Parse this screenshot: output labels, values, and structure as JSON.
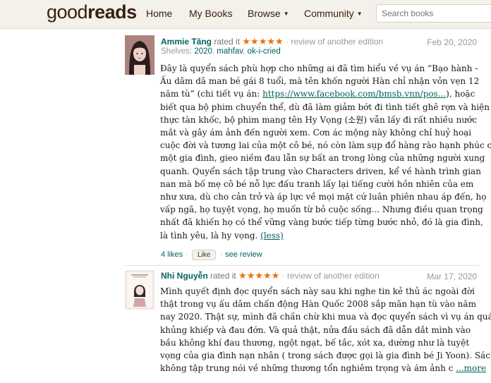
{
  "header": {
    "logo_light": "good",
    "logo_bold": "reads",
    "nav": [
      {
        "label": "Home"
      },
      {
        "label": "My Books"
      },
      {
        "label": "Browse"
      },
      {
        "label": "Community"
      }
    ],
    "search_placeholder": "Search books"
  },
  "reviews": [
    {
      "user": "Ammie Tăng",
      "rated": "rated it",
      "stars": "★★★★★",
      "edition": "review of another edition",
      "date": "Feb 20, 2020",
      "shelves_label": "Shelves:",
      "shelves": [
        "2020",
        "mahfav",
        "ok-i-cried"
      ],
      "lines": [
        "Đây là quyển sách phù hợp cho những ai đã tìm hiểu về vụ án “Bạo hành -",
        "Ấu dâm dã man bé gái 8 tuổi, mà tên khốn người Hàn chỉ nhận vỏn vẹn 12",
        "năm tù” (chi tiết vụ án: ",
        "biết qua bộ phim chuyển thể, dù đã làm giảm bớt đi tình tiết ghê rợn và hiện",
        "thực tàn khốc, bộ phim mang tên Hy Vọng (소원) vẫn lấy đi rất nhiều nước",
        "mắt và gây ám ảnh đến người xem. Cơn ác mộng này không chỉ huỷ hoại",
        "cuộc đời và tương lai của một cô bé, nó còn làm sụp đổ hàng rào hạnh phúc của",
        "một gia đình, gieo niềm đau lẫn sự bất an trong lòng của những người xung",
        "quanh. Quyển sách tập trung vào Characters driven, kể về hành trình gian",
        "nan mà bố mẹ cô bé nỗ lực đấu tranh lấy lại tiếng cười hồn nhiên của em",
        "như xưa, dù cho cản trở và áp lực về mọi mặt cứ luân phiên nhau áp đến, họ",
        "vấp ngã, họ tuyệt vọng, họ muốn từ bỏ cuộc sống... Nhưng điều quan trọng",
        "nhất đã khiến họ có thể vững vàng bước tiếp từng bước nhỏ, đó là gia đình,",
        "là tình yêu, là hy vọng. "
      ],
      "link_text": "https://www.facebook.com/bmsb.vnn/pos...",
      "link_after": "), hoặc",
      "less_text": "(less)",
      "likes": "4 likes",
      "like_button": "Like",
      "see_review": "see review"
    },
    {
      "user": "Nhi Nguyễn",
      "rated": "rated it",
      "stars": "★★★★★",
      "edition": "review of another edition",
      "date": "Mar 17, 2020",
      "lines": [
        "Mình quyết định đọc quyển sách này sau khi nghe tin kẻ thủ ác ngoài đời",
        "thật trong vụ ấu dâm chấn động Hàn Quốc 2008 sắp mãn hạn tù vào năm",
        "nay 2020. Thật sự, mình đã chần chừ khi mua và đọc quyển sách vì vụ án quá",
        "khủng khiếp và đau đớn. Và quả thật, nửa đầu sách đã dẫn dắt mình vào",
        "bầu không khí đau thương, ngột ngạt, bế tắc, xót xa, dường như là tuyệt",
        "vọng của gia đình nạn nhân ( trong sách được gọi là gia đình bé Ji Yoon). Sách",
        "không tập trung nói về những thương tổn nghiêm trọng và ám ảnh c "
      ],
      "more_text": "...more"
    }
  ],
  "colors": {
    "header_bg": "#f4f1ea",
    "link_green": "#00635d",
    "star_orange": "#e87400",
    "logo_brown": "#382110"
  }
}
